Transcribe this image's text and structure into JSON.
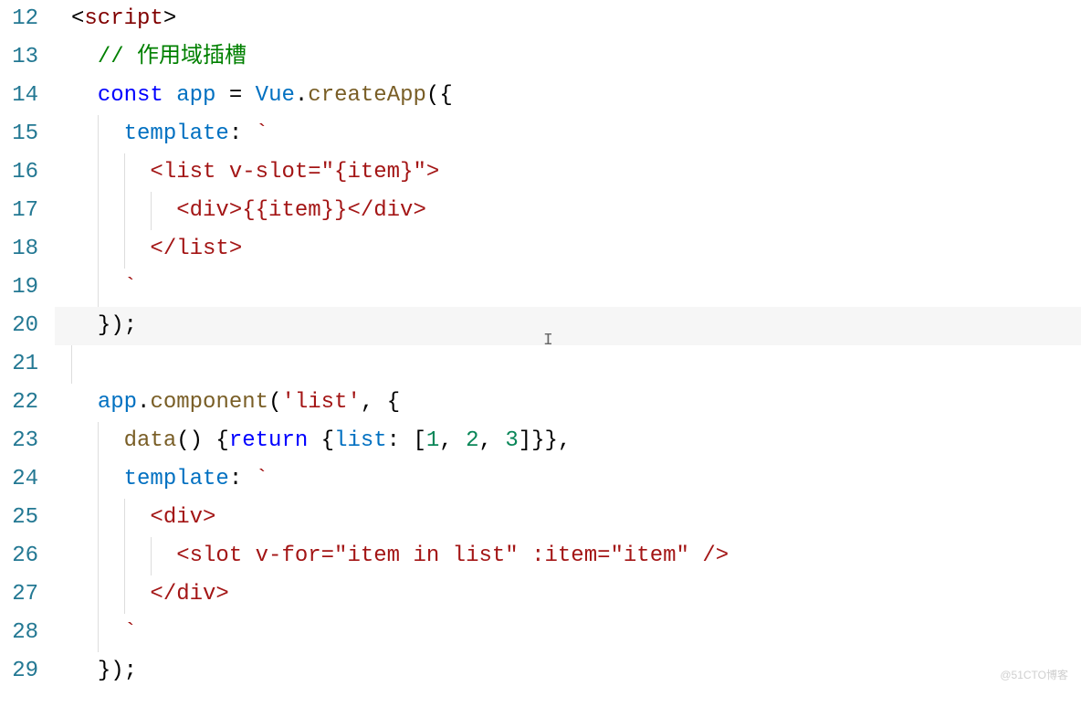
{
  "gutter": {
    "start": 12,
    "end": 29
  },
  "code": {
    "lines": [
      {
        "indent": 0,
        "tokens": [
          {
            "c": "tok-plain",
            "t": "<"
          },
          {
            "c": "tok-tag",
            "t": "script"
          },
          {
            "c": "tok-plain",
            "t": ">"
          }
        ]
      },
      {
        "indent": 1,
        "tokens": [
          {
            "c": "tok-comment",
            "t": "// 作用域插槽"
          }
        ]
      },
      {
        "indent": 1,
        "tokens": [
          {
            "c": "tok-keyword",
            "t": "const"
          },
          {
            "c": "tok-plain",
            "t": " "
          },
          {
            "c": "tok-variable",
            "t": "app"
          },
          {
            "c": "tok-plain",
            "t": " = "
          },
          {
            "c": "tok-variable",
            "t": "Vue"
          },
          {
            "c": "tok-plain",
            "t": "."
          },
          {
            "c": "tok-func",
            "t": "createApp"
          },
          {
            "c": "tok-plain",
            "t": "({"
          }
        ]
      },
      {
        "indent": 2,
        "guides": [
          1
        ],
        "tokens": [
          {
            "c": "tok-variable",
            "t": "template"
          },
          {
            "c": "tok-plain",
            "t": ": "
          },
          {
            "c": "tok-string",
            "t": "`"
          }
        ]
      },
      {
        "indent": 3,
        "guides": [
          1,
          2
        ],
        "tokens": [
          {
            "c": "tok-string",
            "t": "<list v-slot=\"{item}\">"
          }
        ]
      },
      {
        "indent": 4,
        "guides": [
          1,
          2,
          3
        ],
        "tokens": [
          {
            "c": "tok-string",
            "t": "<div>{{item}}</div>"
          }
        ]
      },
      {
        "indent": 3,
        "guides": [
          1,
          2
        ],
        "tokens": [
          {
            "c": "tok-string",
            "t": "</list>"
          }
        ]
      },
      {
        "indent": 2,
        "guides": [
          1
        ],
        "tokens": [
          {
            "c": "tok-string",
            "t": "`"
          }
        ]
      },
      {
        "indent": 1,
        "highlight": true,
        "tokens": [
          {
            "c": "tok-plain",
            "t": "});"
          }
        ]
      },
      {
        "indent": 0,
        "guides": [
          0
        ],
        "tokens": []
      },
      {
        "indent": 1,
        "tokens": [
          {
            "c": "tok-variable",
            "t": "app"
          },
          {
            "c": "tok-plain",
            "t": "."
          },
          {
            "c": "tok-func",
            "t": "component"
          },
          {
            "c": "tok-plain",
            "t": "("
          },
          {
            "c": "tok-string",
            "t": "'list'"
          },
          {
            "c": "tok-plain",
            "t": ", {"
          }
        ]
      },
      {
        "indent": 2,
        "guides": [
          1
        ],
        "tokens": [
          {
            "c": "tok-func",
            "t": "data"
          },
          {
            "c": "tok-plain",
            "t": "() {"
          },
          {
            "c": "tok-keyword",
            "t": "return"
          },
          {
            "c": "tok-plain",
            "t": " {"
          },
          {
            "c": "tok-variable",
            "t": "list"
          },
          {
            "c": "tok-plain",
            "t": ": ["
          },
          {
            "c": "tok-number",
            "t": "1"
          },
          {
            "c": "tok-plain",
            "t": ", "
          },
          {
            "c": "tok-number",
            "t": "2"
          },
          {
            "c": "tok-plain",
            "t": ", "
          },
          {
            "c": "tok-number",
            "t": "3"
          },
          {
            "c": "tok-plain",
            "t": "]}},"
          }
        ]
      },
      {
        "indent": 2,
        "guides": [
          1
        ],
        "tokens": [
          {
            "c": "tok-variable",
            "t": "template"
          },
          {
            "c": "tok-plain",
            "t": ": "
          },
          {
            "c": "tok-string",
            "t": "`"
          }
        ]
      },
      {
        "indent": 3,
        "guides": [
          1,
          2
        ],
        "tokens": [
          {
            "c": "tok-string",
            "t": "<div>"
          }
        ]
      },
      {
        "indent": 4,
        "guides": [
          1,
          2,
          3
        ],
        "tokens": [
          {
            "c": "tok-string",
            "t": "<slot v-for=\"item in list\" :item=\"item\" />"
          }
        ]
      },
      {
        "indent": 3,
        "guides": [
          1,
          2
        ],
        "tokens": [
          {
            "c": "tok-string",
            "t": "</div>"
          }
        ]
      },
      {
        "indent": 2,
        "guides": [
          1
        ],
        "tokens": [
          {
            "c": "tok-string",
            "t": "`"
          }
        ]
      },
      {
        "indent": 1,
        "tokens": [
          {
            "c": "tok-plain",
            "t": "});"
          }
        ]
      }
    ]
  },
  "watermark": "@51CTO博客",
  "indentUnit": "  "
}
